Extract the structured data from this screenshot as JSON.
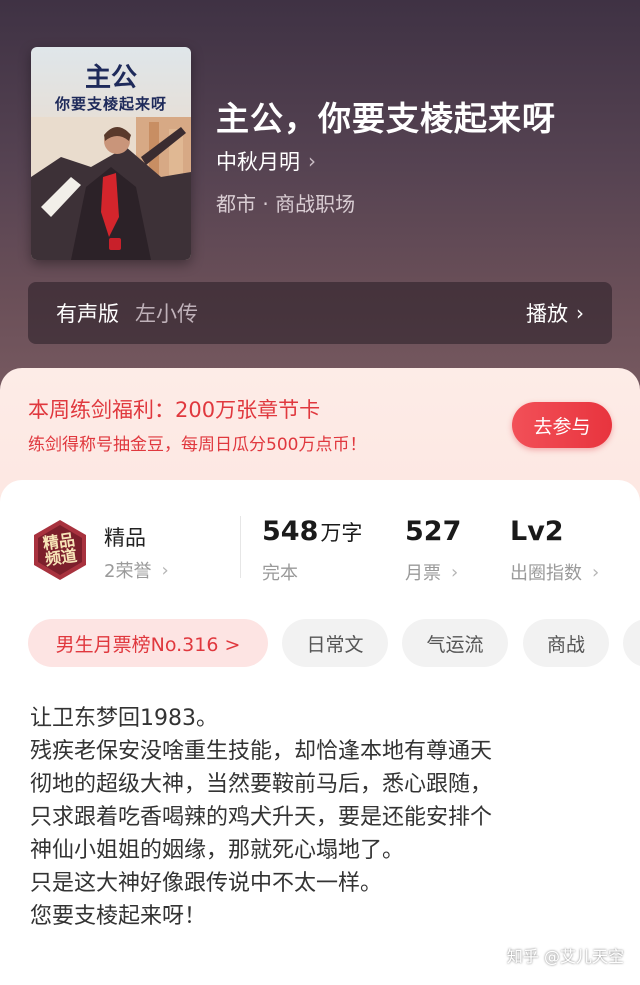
{
  "book": {
    "cover_title_1": "主公",
    "cover_title_2": "你要支棱起来呀",
    "title": "主公，你要支棱起来呀",
    "author": "中秋月明",
    "genre": "都市 · 商战职场"
  },
  "audio": {
    "label": "有声版",
    "narrator": "左小传",
    "play_label": "播放"
  },
  "promo": {
    "title": "本周练剑福利：200万张章节卡",
    "subtitle": "练剑得称号抽金豆，每周日瓜分500万点币！",
    "join_label": "去参与"
  },
  "badge": {
    "text": "精品\n频道",
    "name": "精品",
    "honors": "2荣誉"
  },
  "stats": {
    "words_value": "548",
    "words_unit": "万字",
    "words_label": "完本",
    "tickets_value": "527",
    "tickets_label": "月票",
    "level_value": "Lv2",
    "level_label": "出圈指数"
  },
  "tags": [
    "男生月票榜No.316 >",
    "日常文",
    "气运流",
    "商战"
  ],
  "description": [
    "让卫东梦回1983。",
    "残疾老保安没啥重生技能，却恰逢本地有尊通天",
    "彻地的超级大神，当然要鞍前马后，悉心跟随，",
    "只求跟着吃香喝辣的鸡犬升天，要是还能安排个",
    "神仙小姐姐的姻缘，那就死心塌地了。",
    "只是这大神好像跟传说中不太一样。",
    "您要支棱起来呀！"
  ],
  "watermark": "知乎 @艾儿天空",
  "colors": {
    "accent_red": "#e0383e",
    "hero_bg": "#564352",
    "promo_bg": "#fde7e2"
  },
  "icons": {
    "chevron": "chevron-right-icon",
    "badge": "premium-channel-badge-icon"
  }
}
